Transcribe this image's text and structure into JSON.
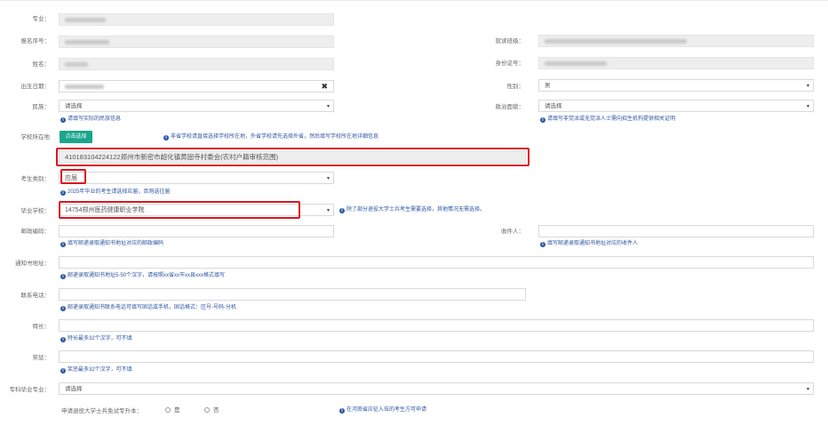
{
  "labels": {
    "major": "专业：",
    "reg_no": "报名序号：",
    "name": "姓名：",
    "birth": "出生日期：",
    "nation": "民族：",
    "school_loc": "学校所在地",
    "exam_type": "考生类别：",
    "grad_school": "毕业学校：",
    "postcode": "邮政编码：",
    "address": "通知书地址：",
    "phone": "联系电话：",
    "specialty": "特长：",
    "awards": "奖惩：",
    "college_major": "专科毕业专业：",
    "retired_soldier": "申请退役大学士兵免试专升本：",
    "class": "就读班级：",
    "id_no": "身份证号：",
    "gender": "性别：",
    "politics": "政治面貌：",
    "recipient": "收件人："
  },
  "values": {
    "birth_clear": "✖",
    "gender": "男",
    "nation_placeholder": "请选择",
    "politics_placeholder": "请选择",
    "school_location": "410183104224122郑州市新密市超化镇黄固寺村委会(农村户籍审核范围)",
    "exam_type": "应届",
    "grad_school": "14754郑州医药健康职业学院",
    "college_major_placeholder": "请选择",
    "radio_yes": "是",
    "radio_no": "否"
  },
  "buttons": {
    "select_location": "点击选择"
  },
  "hints": {
    "nation": "请填写实际的民族信息",
    "politics": "请填写非党派或无党派人士需向招生机构提供相关证明",
    "school_loc": "非省学校请直接选择学校所在地，外省学校请先选择外省，然后填写学校所在地详细信息",
    "exam_type": "2025年毕业的考生请选择应届，否则选往届",
    "grad_school": "除了部分退役大学士兵考生需要选择，其他情况无需选择。",
    "postcode": "填写邮递录取通知书地址对应的邮政编码",
    "recipient": "填写邮递录取通知书地址对应的收件人",
    "address": "邮递录取通知书地址5-50个汉字，请按照xx省xx市xx县xxx格式填写",
    "phone": "邮递录取通知书联系电话可填写固话或手机，固话格式：区号-号码-分机",
    "specialty": "特长最多32个汉字，可不填",
    "awards": "奖惩最多32个汉字，可不填",
    "retired_soldier": "在河南省应征入伍的考生方可申请"
  },
  "icons": {
    "caret": "▾",
    "info": "i"
  },
  "colors": {
    "highlight_red": "#d9151f",
    "hint_blue": "#2c55a3",
    "button_green": "#1aa68b"
  }
}
